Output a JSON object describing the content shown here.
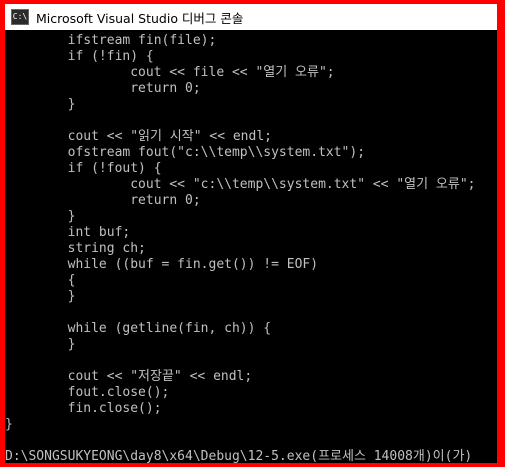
{
  "window": {
    "title": "Microsoft Visual Studio 디버그 콘솔",
    "icon": "console-app-icon",
    "icon_glyph": "C:\\"
  },
  "console": {
    "lines": [
      "        ifstream fin(file);",
      "        if (!fin) {",
      "                cout << file << \"열기 오류\";",
      "                return 0;",
      "        }",
      "",
      "        cout << \"읽기 시작\" << endl;",
      "        ofstream fout(\"c:\\\\temp\\\\system.txt\");",
      "        if (!fout) {",
      "                cout << \"c:\\\\temp\\\\system.txt\" << \"열기 오류\";",
      "                return 0;",
      "        }",
      "        int buf;",
      "        string ch;",
      "        while ((buf = fin.get()) != EOF)",
      "        {",
      "        }",
      "",
      "        while (getline(fin, ch)) {",
      "        }",
      "",
      "        cout << \"저장끝\" << endl;",
      "        fout.close();",
      "        fin.close();",
      "}",
      "",
      "D:\\SONGSUKYEONG\\day8\\x64\\Debug\\12-5.exe(프로세스 14008개)이(가)"
    ]
  },
  "colors": {
    "border": "#ff0000",
    "console_bg": "#000000",
    "console_text": "#c0c0c0",
    "titlebar_bg": "#ffffff"
  }
}
